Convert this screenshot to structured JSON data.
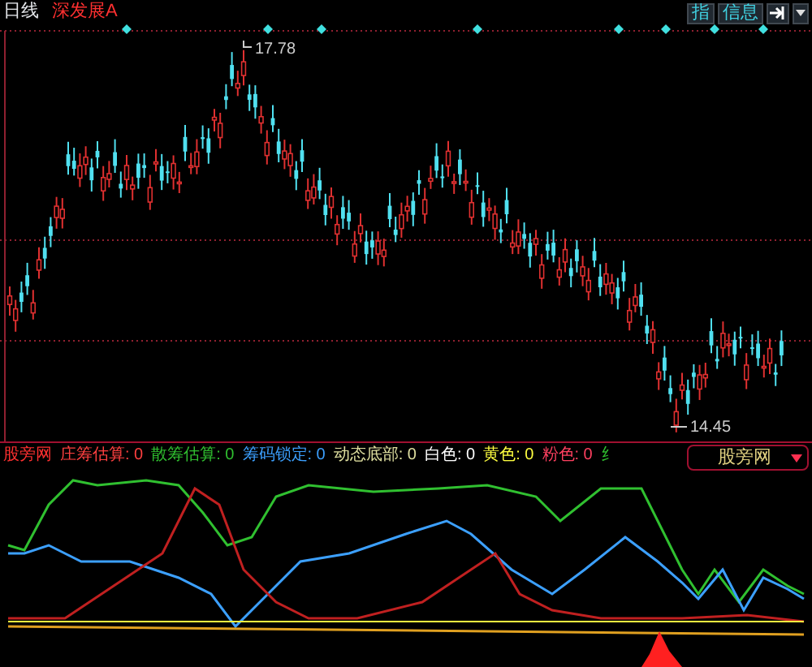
{
  "header": {
    "period": "日线",
    "stock": "深发展A"
  },
  "toolbar": {
    "buttons": [
      "指",
      "信息"
    ]
  },
  "price_chart": {
    "high_label": "17.78",
    "low_label": "14.45"
  },
  "indicator": {
    "name": "股旁网",
    "items": [
      {
        "label": "庄筹估算:",
        "value": "0",
        "color": "#ff4040"
      },
      {
        "label": "散筹估算:",
        "value": "0",
        "color": "#30c030"
      },
      {
        "label": "筹码锁定:",
        "value": "0",
        "color": "#3ca0ff"
      },
      {
        "label": "动态底部:",
        "value": "0",
        "color": "#e0e0a0"
      },
      {
        "label": "白色:",
        "value": "0",
        "color": "#ffffff"
      },
      {
        "label": "黄色:",
        "value": "0",
        "color": "#ffff40"
      },
      {
        "label": "粉色:",
        "value": "0",
        "color": "#ff4060"
      },
      {
        "label": "纟",
        "value": "",
        "color": "#30c030"
      }
    ],
    "dropdown": "股旁网"
  }
}
